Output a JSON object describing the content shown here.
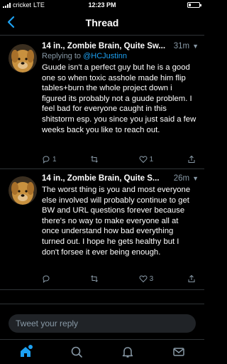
{
  "status_bar": {
    "carrier": "cricket",
    "network": "LTE",
    "time": "12:23 PM",
    "battery_level": 0.2
  },
  "header": {
    "title": "Thread"
  },
  "tweets": [
    {
      "name": "14 in., Zombie Brain, Quite Sw...",
      "time": "31m",
      "replying_prefix": "Replying to",
      "replying_handle": "@HCJustinn",
      "text": "Guude isn't a perfect guy but he is a good one so when toxic asshole made him flip tables+burn the whole project down i figured its probably not a guude problem. I feel bad for everyone caught in this shitstorm esp. you since you just said a few weeks back you like to reach out.",
      "reply_count": "1",
      "retweet_count": "",
      "like_count": "1"
    },
    {
      "name": "14 in., Zombie Brain, Quite S...",
      "time": "26m",
      "text": "The worst thing is you and most everyone else involved will probably continue to get BW and URL  questions forever because there's no way to make everyone all at once understand how bad everything turned out. I hope he gets healthy but I don't forsee it ever being enough.",
      "reply_count": "",
      "retweet_count": "",
      "like_count": "3"
    }
  ],
  "compose": {
    "placeholder": "Tweet your reply"
  },
  "tab_bar": {
    "items": [
      "home-icon",
      "search-icon",
      "notifications-icon",
      "messages-icon"
    ]
  },
  "colors": {
    "accent": "#1da1f2",
    "muted": "#8899a6",
    "background": "#000000",
    "divider": "#2f3336"
  }
}
